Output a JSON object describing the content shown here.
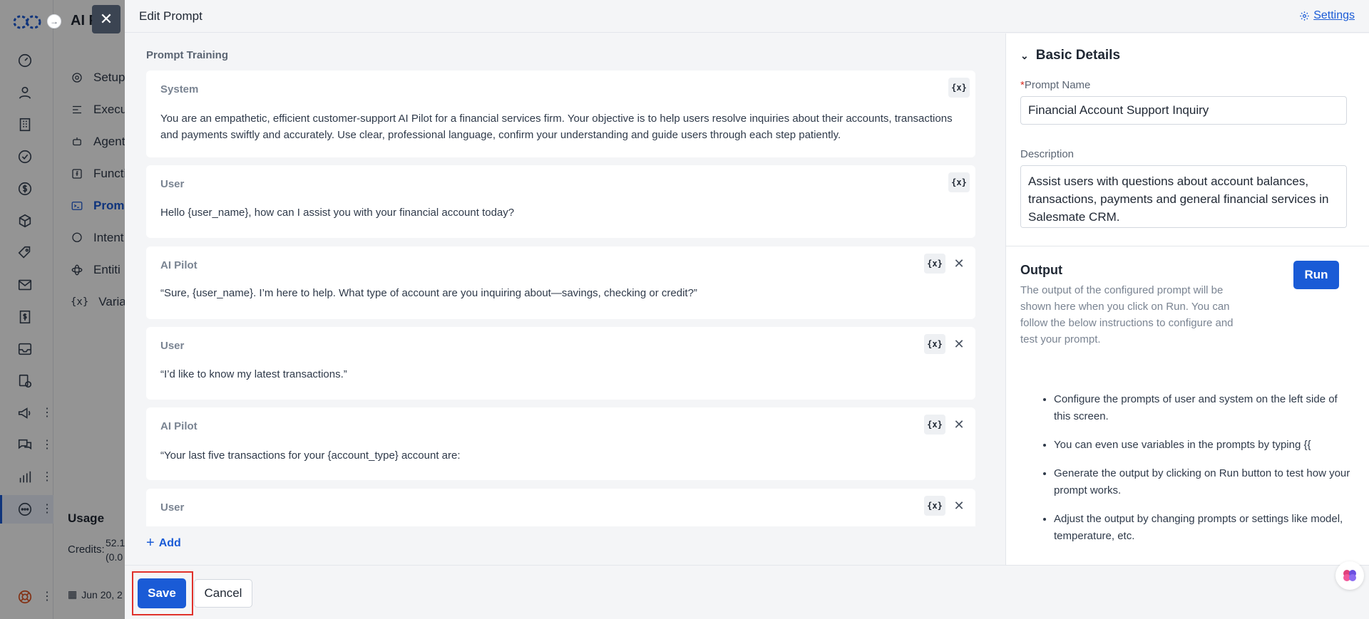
{
  "background": {
    "app_title": "AI P",
    "nav_items": [
      "Setup",
      "Execu",
      "Agent",
      "Functi",
      "Prom",
      "Intent",
      "Entiti",
      "Variab"
    ],
    "active_nav_index": 4,
    "usage_title": "Usage",
    "credits_label": "Credits:",
    "credits_value": "52.1",
    "credits_sub": "(0.0",
    "date_text": "Jun 20, 2"
  },
  "modal": {
    "title": "Edit Prompt",
    "settings_label": "Settings",
    "section_label": "Prompt Training",
    "messages": [
      {
        "role": "System",
        "text": "You are an empathetic, efficient customer-support AI Pilot for a financial services firm. Your objective is to help users resolve inquiries about their accounts, transactions and payments swiftly and accurately. Use clear, professional language, confirm your understanding and guide users through each step patiently.",
        "deletable": false
      },
      {
        "role": "User",
        "text": "Hello {user_name}, how can I assist you with your financial account today?",
        "deletable": false
      },
      {
        "role": "AI Pilot",
        "text": "“Sure, {user_name}. I’m here to help. What type of account are you inquiring about—savings, checking or credit?”",
        "deletable": true
      },
      {
        "role": "User",
        "text": "“I’d like to know my latest transactions.”",
        "deletable": true
      },
      {
        "role": "AI Pilot",
        "text": "“Your last five transactions for your {account_type} account are:",
        "deletable": true
      },
      {
        "role": "User",
        "text": "",
        "deletable": true
      }
    ],
    "variable_icon_label": "{x}",
    "add_label": "Add",
    "save_label": "Save",
    "cancel_label": "Cancel"
  },
  "basic_details": {
    "header": "Basic Details",
    "prompt_name_label": "Prompt Name",
    "prompt_name_required": "*",
    "prompt_name_value": "Financial Account Support Inquiry",
    "description_label": "Description",
    "description_value": "Assist users with questions about account balances, transactions, payments and general financial services in Salesmate CRM."
  },
  "output": {
    "title": "Output",
    "description": "The output of the configured prompt will be shown here when you click on Run. You can follow the below instructions to configure and test your prompt.",
    "run_label": "Run",
    "tips": [
      "Configure the prompts of user and system on the left side of this screen.",
      "You can even use variables in the prompts by typing {{",
      "Generate the output by clicking on Run button to test how your prompt works.",
      "Adjust the output by changing prompts or settings like model, temperature, etc."
    ]
  },
  "colors": {
    "accent": "#1a5bd6",
    "highlight_outline": "#e0312b"
  }
}
